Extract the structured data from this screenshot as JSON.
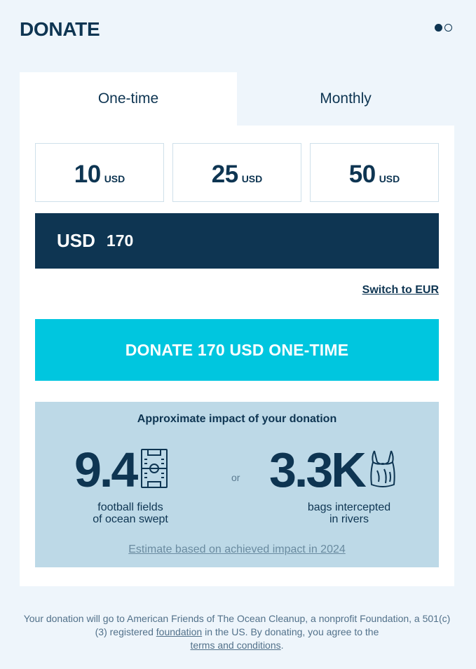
{
  "header": {
    "title": "DONATE",
    "pagination": {
      "current": 1,
      "total": 2
    }
  },
  "tabs": [
    {
      "label": "One-time",
      "active": true
    },
    {
      "label": "Monthly",
      "active": false
    }
  ],
  "amounts": [
    {
      "value": "10",
      "currency": "USD"
    },
    {
      "value": "25",
      "currency": "USD"
    },
    {
      "value": "50",
      "currency": "USD"
    }
  ],
  "custom_amount": {
    "currency": "USD",
    "value": "170"
  },
  "switch_currency": "Switch to EUR",
  "donate_button": "DONATE 170 USD ONE-TIME",
  "impact": {
    "title": "Approximate impact of your donation",
    "stat1": {
      "value": "9.4",
      "label_line1": "football fields",
      "label_line2": "of ocean swept",
      "icon": "football-field-icon"
    },
    "separator": "or",
    "stat2": {
      "value": "3.3K",
      "label_line1": "bags intercepted",
      "label_line2": "in rivers",
      "icon": "plastic-bag-icon"
    },
    "estimate": "Estimate based on achieved impact in 2024"
  },
  "footer": {
    "part1": "Your donation will go to American Friends of The Ocean Cleanup, a nonprofit Foundation, a 501(c)(3) registered ",
    "link1": "foundation",
    "part2": " in the US. By donating, you agree to the ",
    "link2": "terms and conditions",
    "part3": "."
  },
  "colors": {
    "navy": "#0e3552",
    "cyan": "#00c6df",
    "impact_bg": "#bdd9e7",
    "page_bg": "#eef5fb"
  }
}
